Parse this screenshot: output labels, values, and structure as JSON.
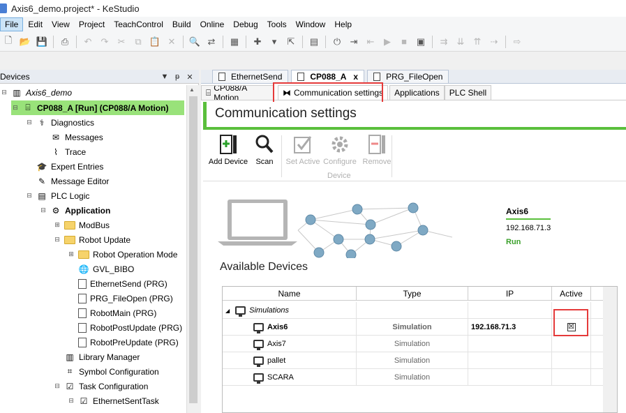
{
  "window": {
    "title": "Axis6_demo.project* - KeStudio"
  },
  "menu": [
    "File",
    "Edit",
    "View",
    "Project",
    "TeachControl",
    "Build",
    "Online",
    "Debug",
    "Tools",
    "Window",
    "Help"
  ],
  "devices_panel": {
    "title": "Devices",
    "tools": [
      "▼",
      "ᵽ",
      "✕"
    ],
    "tree": [
      {
        "label": "Axis6_demo",
        "style": "italic"
      },
      {
        "label": "CP088_A [Run] (CP088/A Motion)",
        "style": "bold"
      },
      {
        "label": "Diagnostics"
      },
      {
        "label": "Messages"
      },
      {
        "label": "Trace"
      },
      {
        "label": "Expert Entries"
      },
      {
        "label": "Message Editor"
      },
      {
        "label": "PLC Logic"
      },
      {
        "label": "Application",
        "style": "bold"
      },
      {
        "label": "ModBus"
      },
      {
        "label": "Robot Update"
      },
      {
        "label": "Robot Operation Mode"
      },
      {
        "label": "GVL_BIBO"
      },
      {
        "label": "EthernetSend (PRG)"
      },
      {
        "label": "PRG_FileOpen (PRG)"
      },
      {
        "label": "RobotMain (PRG)"
      },
      {
        "label": "RobotPostUpdate (PRG)"
      },
      {
        "label": "RobotPreUpdate (PRG)"
      },
      {
        "label": "Library Manager"
      },
      {
        "label": "Symbol Configuration"
      },
      {
        "label": "Task Configuration"
      },
      {
        "label": "EthernetSentTask"
      }
    ]
  },
  "doc_tabs": [
    {
      "label": "EthernetSend"
    },
    {
      "label": "CP088_A",
      "close": "x"
    },
    {
      "label": "PRG_FileOpen"
    }
  ],
  "sub_tabs": [
    "CP088/A Motion",
    "Communication settings",
    "Applications",
    "PLC Shell"
  ],
  "section_title": "Communication settings",
  "ribbon": {
    "add_device": "Add Device",
    "scan": "Scan",
    "set_active": "Set Active",
    "configure": "Configure",
    "remove": "Remove",
    "device_group": "Device"
  },
  "active_device": {
    "name": "Axis6",
    "ip": "192.168.71.3",
    "status": "Run",
    "status_color": "#3aa02a"
  },
  "available_devices": {
    "label": "Available Devices",
    "columns": [
      "Name",
      "Type",
      "IP",
      "Active"
    ],
    "group": "Simulations",
    "rows": [
      {
        "name": "Axis6",
        "type": "Simulation",
        "ip": "192.168.71.3",
        "active": "☒"
      },
      {
        "name": "Axis7",
        "type": "Simulation",
        "ip": "",
        "active": ""
      },
      {
        "name": "pallet",
        "type": "Simulation",
        "ip": "",
        "active": ""
      },
      {
        "name": "SCARA",
        "type": "Simulation",
        "ip": "",
        "active": ""
      }
    ]
  },
  "colors": {
    "accent_green": "#5abf3c",
    "highlight": "#99e27a",
    "annotation_red": "#e53a3a"
  }
}
